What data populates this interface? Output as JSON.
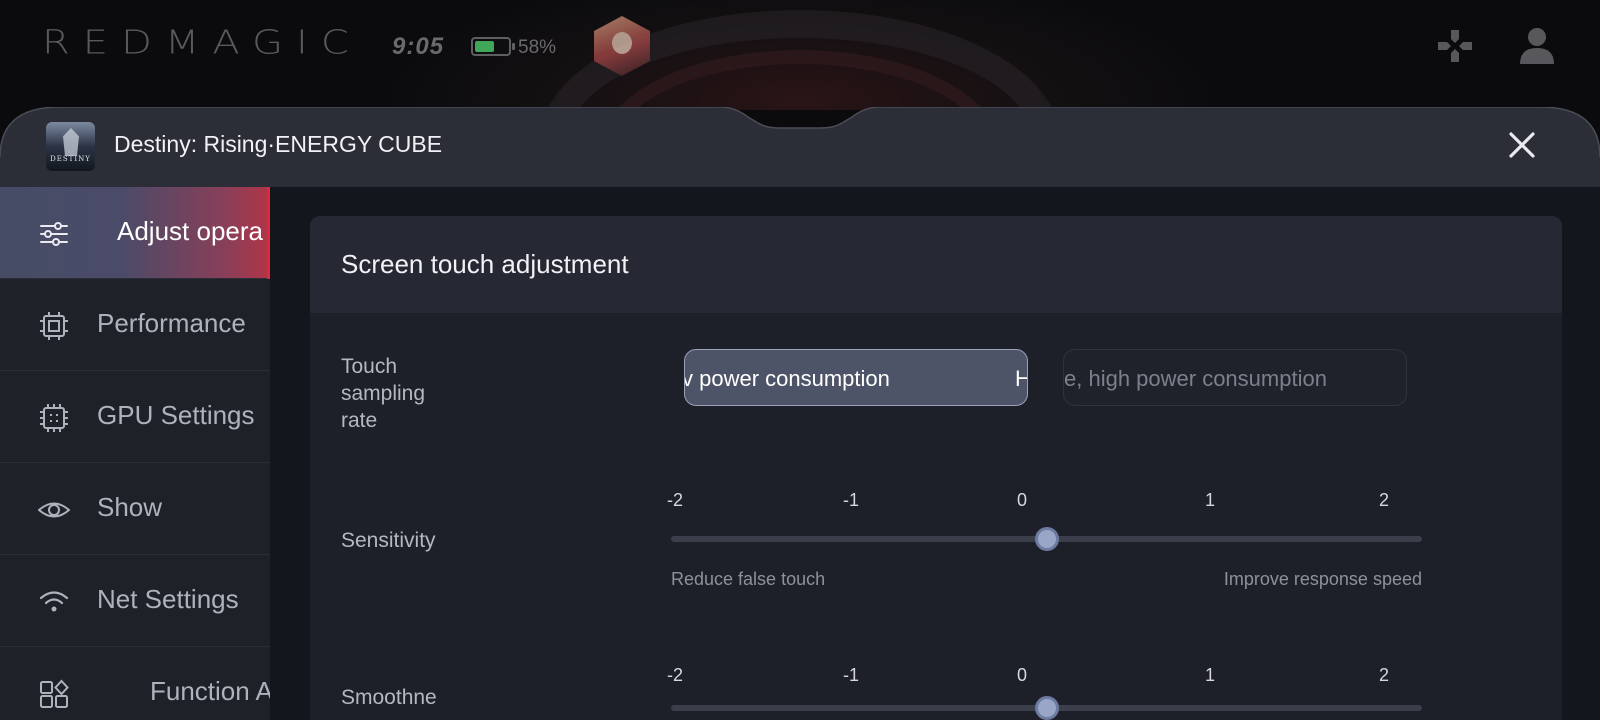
{
  "status_bar": {
    "brand": "REDMAGIC",
    "time": "9:05",
    "battery_percent": "58%",
    "battery_level": 0.58,
    "battery_color": "#3fa65a",
    "icons": [
      "avatar",
      "gamepad-icon",
      "user-icon"
    ]
  },
  "panel": {
    "game_badge": "DESTINY",
    "title": "Destiny: Rising·ENERGY CUBE"
  },
  "sidebar": {
    "items": [
      {
        "label": "Adjust opera",
        "icon": "sliders-icon",
        "active": true
      },
      {
        "label": "Performance",
        "icon": "chip-icon",
        "active": false
      },
      {
        "label": "GPU Settings",
        "icon": "gpu-icon",
        "active": false
      },
      {
        "label": "Show",
        "icon": "eye-icon",
        "active": false
      },
      {
        "label": "Net Settings",
        "icon": "wifi-icon",
        "active": false
      },
      {
        "label": "Function A",
        "icon": "apps-icon",
        "active": false
      }
    ]
  },
  "main": {
    "section_title": "Screen touch adjustment",
    "touch_sampling": {
      "label": "Touch sampling rate",
      "options": [
        {
          "text": "v power consumption",
          "selected": true,
          "trailing": "H"
        },
        {
          "text": "e, high power consumption",
          "selected": false
        }
      ]
    },
    "sensitivity": {
      "label": "Sensitivity",
      "ticks": [
        "-2",
        "-1",
        "0",
        "1",
        "2"
      ],
      "value": 0,
      "min_hint": "Reduce false touch",
      "max_hint": "Improve response speed"
    },
    "smoothness": {
      "label": "Smoothne",
      "ticks": [
        "-2",
        "-1",
        "0",
        "1",
        "2"
      ],
      "value": 0
    }
  },
  "colors": {
    "accent_red": "#e0283c",
    "panel_bg": "#262833",
    "sidebar_bg": "#1f2129"
  }
}
